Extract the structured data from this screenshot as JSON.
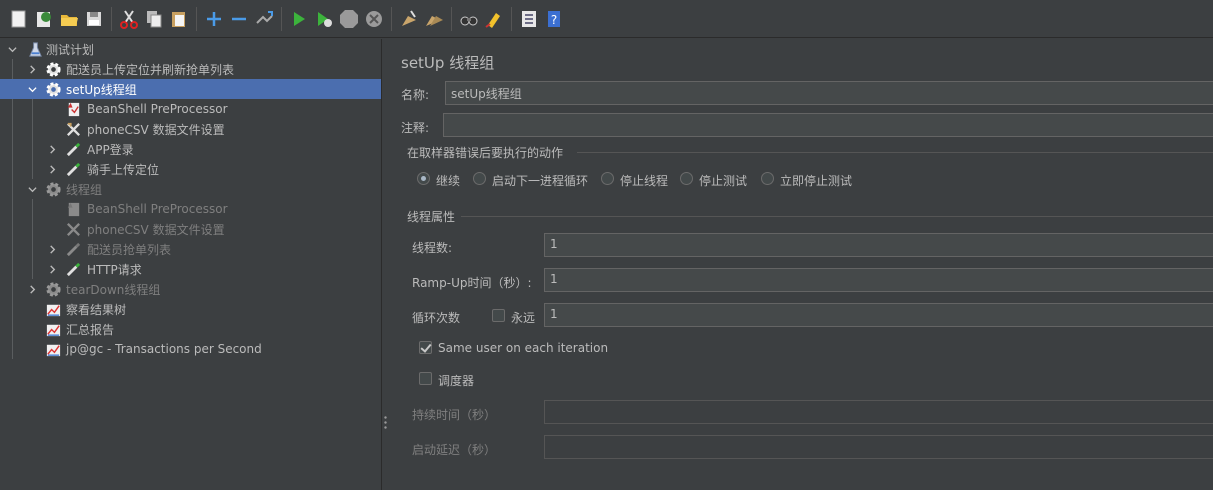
{
  "toolbar": {
    "icons": [
      "new-icon",
      "templates-icon",
      "open-icon",
      "save-icon",
      "cut-icon",
      "copy-icon",
      "paste-icon",
      "expand-icon",
      "collapse-icon",
      "toggle-icon",
      "start-icon",
      "start-no-pause-icon",
      "stop-icon",
      "shutdown-icon",
      "clear-icon",
      "clear-all-icon",
      "search-icon",
      "reset-search-icon",
      "function-helper-icon",
      "help-icon"
    ]
  },
  "tree": {
    "items": [
      {
        "label": "测试计划",
        "icon": "test-plan-icon",
        "enabled": true
      },
      {
        "label": "配送员上传定位并刷新抢单列表",
        "icon": "thread-group-icon",
        "enabled": true
      },
      {
        "label": "setUp线程组",
        "icon": "thread-group-icon",
        "enabled": true,
        "selected": true
      },
      {
        "label": "BeanShell PreProcessor",
        "icon": "preprocessor-icon",
        "enabled": true
      },
      {
        "label": "phoneCSV 数据文件设置",
        "icon": "config-icon",
        "enabled": true
      },
      {
        "label": "APP登录",
        "icon": "sampler-icon",
        "enabled": true
      },
      {
        "label": "骑手上传定位",
        "icon": "sampler-icon",
        "enabled": true
      },
      {
        "label": "线程组",
        "icon": "thread-group-icon",
        "enabled": false
      },
      {
        "label": "BeanShell PreProcessor",
        "icon": "preprocessor-icon",
        "enabled": false
      },
      {
        "label": "phoneCSV 数据文件设置",
        "icon": "config-icon",
        "enabled": false
      },
      {
        "label": "配送员抢单列表",
        "icon": "sampler-icon",
        "enabled": false
      },
      {
        "label": "HTTP请求",
        "icon": "sampler-icon",
        "enabled": true
      },
      {
        "label": "tearDown线程组",
        "icon": "thread-group-icon",
        "enabled": false
      },
      {
        "label": "察看结果树",
        "icon": "listener-icon",
        "enabled": true
      },
      {
        "label": "汇总报告",
        "icon": "listener-icon",
        "enabled": true
      },
      {
        "label": "jp@gc - Transactions per Second",
        "icon": "listener-icon",
        "enabled": true
      }
    ]
  },
  "panel": {
    "title": "setUp 线程组",
    "name_label": "名称:",
    "name_value": "setUp线程组",
    "comment_label": "注释:",
    "comment_value": "",
    "error_group_title": "在取样器错误后要执行的动作",
    "error_actions": [
      {
        "label": "继续",
        "selected": true
      },
      {
        "label": "启动下一进程循环",
        "selected": false
      },
      {
        "label": "停止线程",
        "selected": false
      },
      {
        "label": "停止测试",
        "selected": false
      },
      {
        "label": "立即停止测试",
        "selected": false
      }
    ],
    "thread_props_title": "线程属性",
    "threads_label": "线程数:",
    "threads_value": "1",
    "rampup_label": "Ramp-Up时间（秒）:",
    "rampup_value": "1",
    "loop_label": "循环次数",
    "forever_label": "永远",
    "forever_checked": false,
    "loop_value": "1",
    "same_user_label": "Same user on each iteration",
    "same_user_checked": true,
    "scheduler_label": "调度器",
    "scheduler_checked": false,
    "duration_label": "持续时间（秒）",
    "duration_value": "",
    "delay_label": "启动延迟（秒）",
    "delay_value": ""
  },
  "colors": {
    "background": "#3c3f41",
    "selection": "#4b6eaf",
    "field": "#45494a",
    "text": "#bbbbbb",
    "disabled_text": "#7f7f7f"
  }
}
